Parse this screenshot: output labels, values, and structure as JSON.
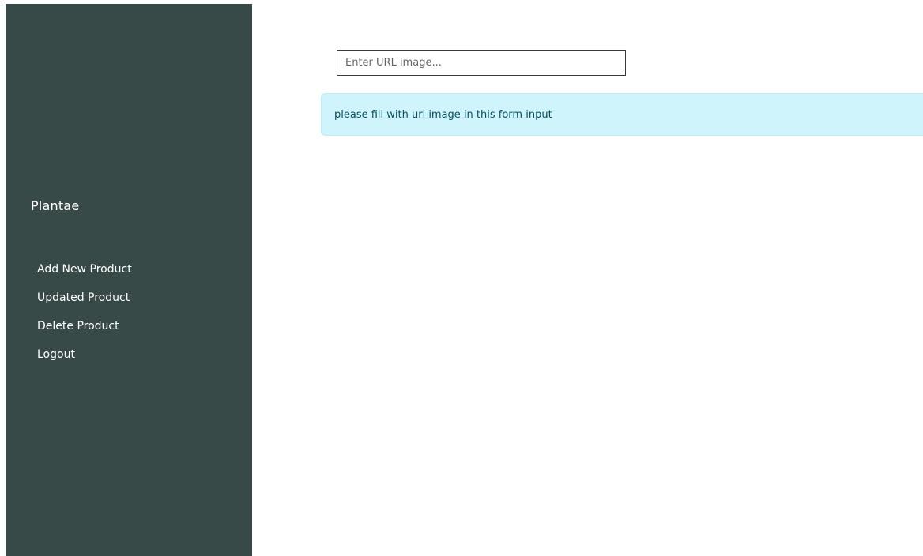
{
  "sidebar": {
    "brand": "Plantae",
    "items": [
      {
        "label": "Add New Product"
      },
      {
        "label": "Updated Product"
      },
      {
        "label": "Delete Product"
      },
      {
        "label": "Logout"
      }
    ]
  },
  "form": {
    "url_input": {
      "value": "",
      "placeholder": "Enter URL image..."
    }
  },
  "alert": {
    "message": "please fill with url image in this form input"
  },
  "colors": {
    "sidebar_bg": "#384a48",
    "alert_bg": "#cff4fc",
    "alert_text": "#055160"
  }
}
